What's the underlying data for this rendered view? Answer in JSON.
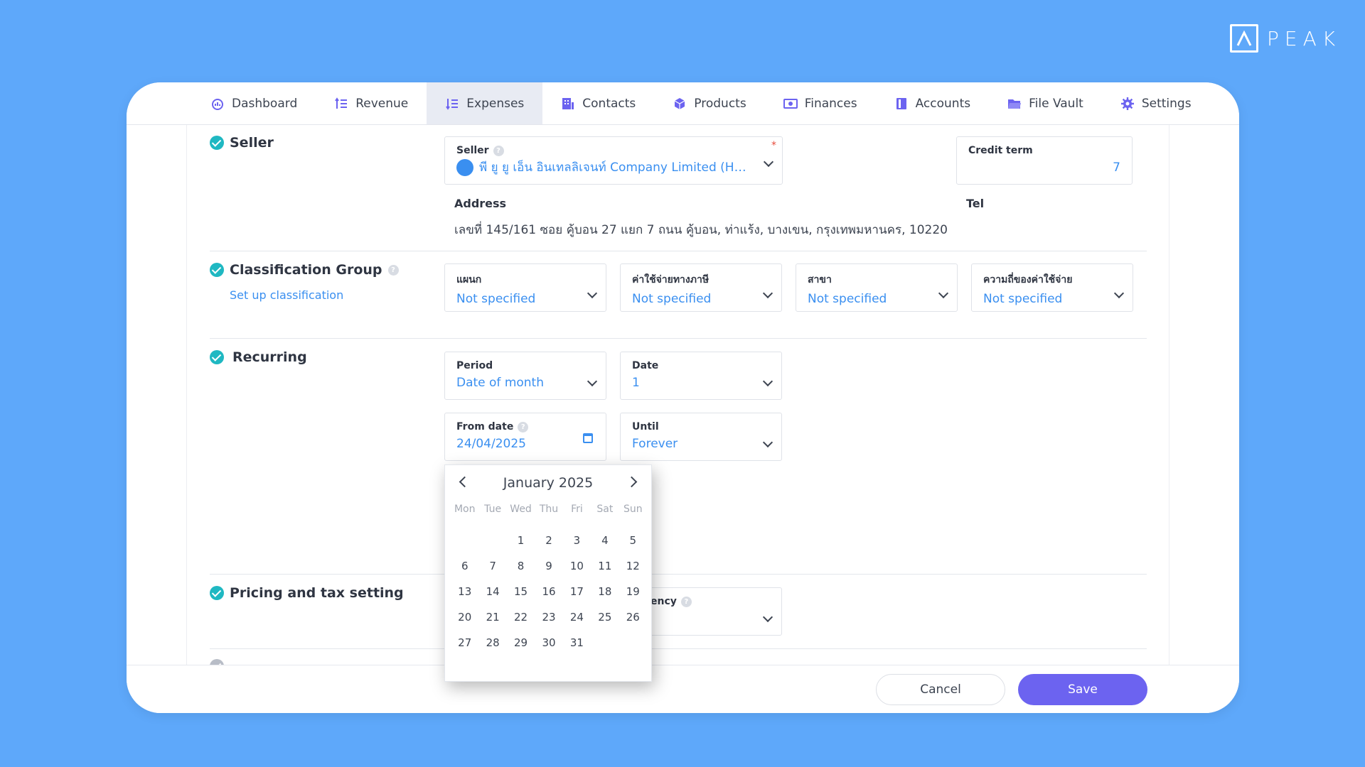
{
  "brand": {
    "logo_text": "PEAK"
  },
  "nav": [
    {
      "label": "Dashboard",
      "icon": "dashboard-icon",
      "active": false
    },
    {
      "label": "Revenue",
      "icon": "revenue-icon",
      "active": false
    },
    {
      "label": "Expenses",
      "icon": "expenses-icon",
      "active": true
    },
    {
      "label": "Contacts",
      "icon": "contacts-icon",
      "active": false
    },
    {
      "label": "Products",
      "icon": "products-icon",
      "active": false
    },
    {
      "label": "Finances",
      "icon": "finances-icon",
      "active": false
    },
    {
      "label": "Accounts",
      "icon": "accounts-icon",
      "active": false
    },
    {
      "label": "File Vault",
      "icon": "folder-icon",
      "active": false
    },
    {
      "label": "Settings",
      "icon": "gear-icon",
      "active": false
    }
  ],
  "seller": {
    "section_title": "Seller",
    "field_label": "Seller",
    "value": "พี ยู ยู เอ็น อินเทลลิเจนท์ Company Limited (Head...",
    "required_mark": "*",
    "credit_term_label": "Credit term",
    "credit_term_value": "7",
    "address_label": "Address",
    "address": "เลขที่ 145/161 ซอย คู้บอน 27 แยก 7 ถนน คู้บอน, ท่าแร้ง, บางเขน, กรุงเทพมหานคร, 10220",
    "tel_label": "Tel"
  },
  "classification": {
    "section_title": "Classification Group",
    "setup_link": "Set up classification",
    "fields": [
      {
        "label": "แผนก",
        "value": "Not specified"
      },
      {
        "label": "ค่าใช้จ่ายทางภาษี",
        "value": "Not specified"
      },
      {
        "label": "สาขา",
        "value": "Not specified"
      },
      {
        "label": "ความถี่ของค่าใช้จ่าย",
        "value": "Not specified"
      }
    ]
  },
  "recurring": {
    "section_title": "Recurring",
    "period_label": "Period",
    "period_value": "Date of month",
    "date_label": "Date",
    "date_value": "1",
    "from_label": "From date",
    "from_value": "24/04/2025",
    "until_label": "Until",
    "until_value": "Forever"
  },
  "pricing": {
    "section_title": "Pricing and tax setting",
    "currency_label_partial": "ency"
  },
  "calendar": {
    "month_label": "January 2025",
    "weekdays": [
      "Mon",
      "Tue",
      "Wed",
      "Thu",
      "Fri",
      "Sat",
      "Sun"
    ],
    "leading_blanks": 2,
    "days": [
      "1",
      "2",
      "3",
      "4",
      "5",
      "6",
      "7",
      "8",
      "9",
      "10",
      "11",
      "12",
      "13",
      "14",
      "15",
      "16",
      "17",
      "18",
      "19",
      "20",
      "21",
      "22",
      "23",
      "24",
      "25",
      "26",
      "27",
      "28",
      "29",
      "30",
      "31"
    ]
  },
  "footer": {
    "cancel_label": "Cancel",
    "save_label": "Save"
  },
  "colors": {
    "background": "#5ea8fa",
    "accent": "#6c63f0",
    "link": "#3a8ff0",
    "check": "#1fb8c2"
  }
}
